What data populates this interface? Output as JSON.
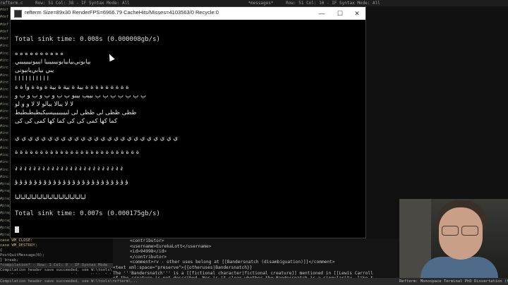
{
  "editor": {
    "top_bar": [
      "refterm.c",
      "Row: 51 Col: 38 - IF Syntax Mode: All",
      "*messages*",
      "Row: 51 Col: 10 - IF Syntax Mode: All"
    ],
    "left_code": [
      "#def",
      "#def",
      "#def",
      "#def",
      "#def",
      "#inc",
      "#inc",
      "#inc",
      "#inc",
      "#inc",
      "#inc",
      "#inc",
      "#inc",
      "#inc",
      "#inc",
      "#inc",
      "#inc",
      "#inc",
      "#inc",
      "#inc",
      "#inc",
      "#inc",
      "#inc",
      "#inc",
      "#prag",
      "#prag",
      "#prag",
      "#prag",
      "#prag",
      "#prag",
      "#prag",
      "#prag"
    ],
    "left_lower": [
      {
        "text": "case WM_CLOSE:",
        "kw": true
      },
      {
        "text": "case WM_DESTROY:",
        "kw": true
      },
      {
        "text": "{",
        "kw": false
      },
      {
        "text": "    PostQuitMessage(0);",
        "kw": false
      },
      {
        "text": "} break;",
        "kw": false
      },
      {
        "text": "*compilation* - Row: 1 Col: 0 - IF Syntax Mode",
        "kw": false,
        "status": true
      },
      {
        "text": "Compilation header save succeeded, see W:\\tools\\ref",
        "kw": false
      },
      {
        "text": "compilation header save succeeded, see W:\\tools\\ref",
        "kw": false
      }
    ],
    "xml_lines": [
      "<contributor>",
      "  <username>EurekaLott</username>",
      "  <id>94998</id>",
      "</contributor>",
      "<comment>rv - other uses belong at [[Bandersnatch (disambiguation)]]</comment>",
      "<text xml:space=\"preserve\">{{otheruses|Bandersnatch}}",
      "The '''Bandersnatch''' is a [[fictional character|fictional creature]] mentioned in [[Lewis Carroll",
      "of the creature is not described. Nor is it clear whether the Bandersnatch is a singularity, like t"
    ],
    "bottom_bar": "Compilation header save succeeded, see W:\\tools\\refterm\\...",
    "bottom_right": "Refterm: Monospace Terminal PhD Dissertation (handmadehero.org)"
  },
  "terminal": {
    "title": "refterm Size=89x30 RenderFPS=6966.79 CacheHits/Misses=4103563/0 Recycle:0",
    "buttons": {
      "minimize": "—",
      "maximize": "☐",
      "close": "✕"
    },
    "sink_line_1": "Total sink time: 0.008s (0.000008gb/s)",
    "glyph_lines": [
      "ه ‌ه ‌ه ‌ه ‌ه ‌ه ‌ه ‌ه ‌ه ‌ه",
      "بيابونى‌بيابيابونيببيبيا ايبيونيبيبيبي",
      "يبي بيابي‌يا‌بيونى",
      "ا ا ا ا ا ا ا ا ا ا",
      "ة ة ة ة ة ة ة ة ة بية ة بية ة بية ة وة ة وا ة ة",
      "ب ب ب ب ب ب ب بيبب بيبو ب ب و ب و ب و ب و",
      "لا لا يبالا يبالو لا لا و و لو",
      "ظظى ظظى لى ظظى لى لبيبيبيبيسبكبطبطبطبط",
      "كما كها كمى كى كى كما كها كمى كى كى",
      "ي ي ي ي ي ي ي ي ي ي ي ي ي ي ي ي ي ي ي ي ي ي ي ي ي",
      "ة ة ة ة ة ة ة ة ة ة ة ة ة ة ة ة ة ة ة ة ة ة ة ة ة",
      "ډ ډ ډ ډ ډ ډ ډ ډ ډ ډ ډ ډ ډ ډ ډ ډ ډ ډ ډ ډ ډ ډ ډ ډ",
      "ؤ ؤ ؤ ؤ ؤ ؤ ؤ ؤ ؤ ؤ ؤ ؤ ؤ ؤ ؤ ؤ ؤ ؤ ؤ ؤ ؤ ؤ ؤ ؤ",
      "لبالبالبالبالبالبالبالبالبالبالبالبالبا"
    ],
    "sink_line_2": "Total sink time: 0.007s (0.000175gb/s)"
  }
}
